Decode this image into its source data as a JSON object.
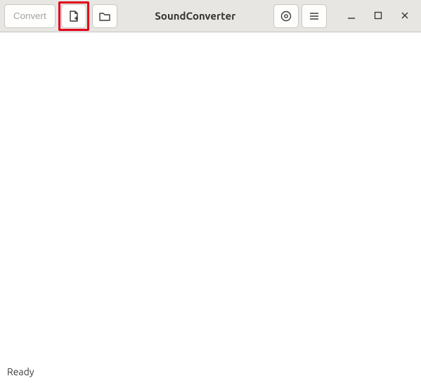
{
  "header": {
    "title": "SoundConverter",
    "convert_label": "Convert"
  },
  "icons": {
    "add_file": "add-file-icon",
    "add_folder": "add-folder-icon",
    "settings": "settings-icon",
    "menu": "hamburger-icon",
    "minimize": "minimize-icon",
    "maximize": "maximize-icon",
    "close": "close-icon"
  },
  "status": {
    "text": "Ready"
  }
}
